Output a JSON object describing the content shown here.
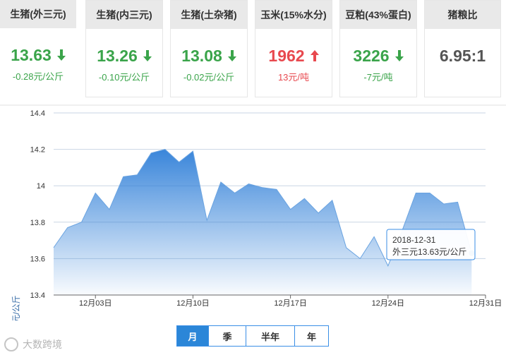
{
  "cards": [
    {
      "title": "生猪(外三元)",
      "price": "13.63",
      "direction": "down",
      "change": "-0.28元/公斤"
    },
    {
      "title": "生猪(内三元)",
      "price": "13.26",
      "direction": "down",
      "change": "-0.10元/公斤"
    },
    {
      "title": "生猪(土杂猪)",
      "price": "13.08",
      "direction": "down",
      "change": "-0.02元/公斤"
    },
    {
      "title": "玉米(15%水分)",
      "price": "1962",
      "direction": "up",
      "change": "13元/吨"
    },
    {
      "title": "豆粕(43%蛋白)",
      "price": "3226",
      "direction": "down",
      "change": "-7元/吨"
    },
    {
      "title": "猪粮比",
      "price": "6.95:1",
      "direction": "none",
      "change": ""
    }
  ],
  "colors": {
    "down": "#3aa44a",
    "up": "#e8494f",
    "neutral": "#555555",
    "line": "#6aa3e0",
    "accent": "#2b86d8"
  },
  "chart_data": {
    "type": "area",
    "ylabel": "元/公斤",
    "ylim": [
      13.4,
      14.4
    ],
    "yticks": [
      13.4,
      13.6,
      13.8,
      14,
      14.2,
      14.4
    ],
    "ytick_labels": [
      "13.4",
      "13.6",
      "13.8",
      "14",
      "14.2",
      "14.4"
    ],
    "xtick_labels": [
      "12月03日",
      "12月10日",
      "12月17日",
      "12月24日",
      "12月31日"
    ],
    "xtick_dates": [
      "2018-12-03",
      "2018-12-10",
      "2018-12-17",
      "2018-12-24",
      "2018-12-31"
    ],
    "x": [
      "2018-11-30",
      "2018-12-01",
      "2018-12-02",
      "2018-12-03",
      "2018-12-04",
      "2018-12-05",
      "2018-12-06",
      "2018-12-07",
      "2018-12-08",
      "2018-12-09",
      "2018-12-10",
      "2018-12-11",
      "2018-12-12",
      "2018-12-13",
      "2018-12-14",
      "2018-12-15",
      "2018-12-16",
      "2018-12-17",
      "2018-12-18",
      "2018-12-19",
      "2018-12-20",
      "2018-12-21",
      "2018-12-22",
      "2018-12-23",
      "2018-12-24",
      "2018-12-25",
      "2018-12-26",
      "2018-12-27",
      "2018-12-28",
      "2018-12-29",
      "2018-12-30",
      "2018-12-31"
    ],
    "values": [
      13.66,
      13.77,
      13.8,
      13.96,
      13.87,
      14.05,
      14.06,
      14.18,
      14.2,
      14.13,
      14.19,
      13.81,
      14.02,
      13.96,
      14.01,
      13.99,
      13.98,
      13.87,
      13.93,
      13.85,
      13.92,
      13.66,
      13.6,
      13.72,
      13.56,
      13.75,
      13.96,
      13.96,
      13.9,
      13.91,
      13.63
    ],
    "grid": true,
    "tooltip": {
      "date": "2018-12-31",
      "text": "外三元13.63元/公斤"
    },
    "highlight_index": 31
  },
  "tabs": [
    "月",
    "季",
    "半年",
    "年"
  ],
  "active_tab": "月",
  "watermark": "大数跨境"
}
